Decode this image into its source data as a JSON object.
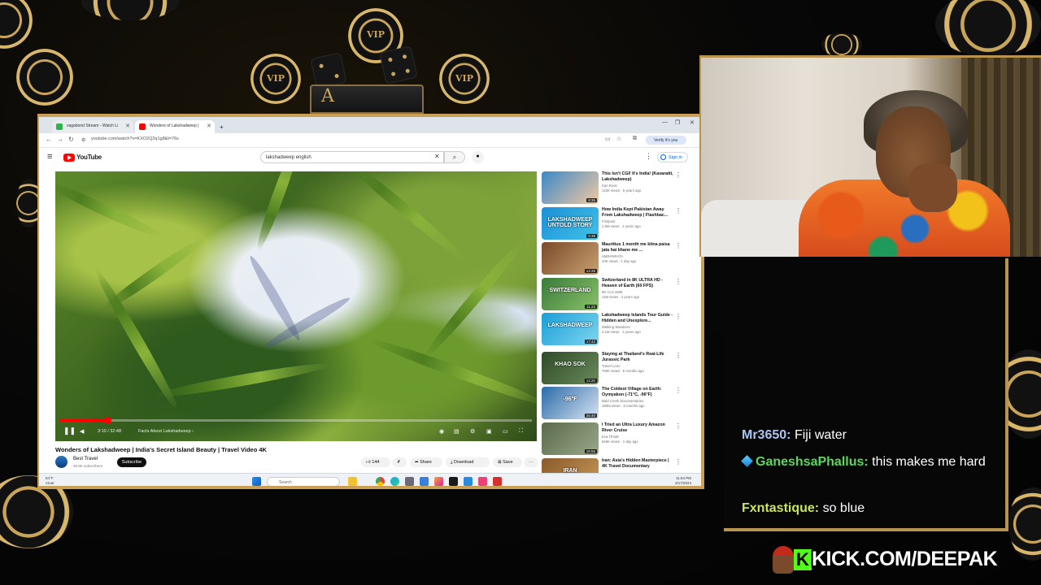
{
  "overlay": {
    "chip_text": "VIP",
    "card_letter": "A",
    "kick_banner": "KICK.COM/DEEPAK",
    "kick_logo_letter": "K"
  },
  "browser": {
    "tabs": [
      {
        "label": "vagabond Stream - Watch Li",
        "favicon_color": "#2db34a"
      },
      {
        "label": "Wonders of Lakshadweep |",
        "favicon_color": "#ff0000"
      }
    ],
    "new_tab_label": "+",
    "url": "youtube.com/watch?v=KXO2Q2q1g8&t=76s",
    "verify_label": "Verify it's you",
    "window_controls": [
      "—",
      "❐",
      "✕"
    ]
  },
  "youtube": {
    "logo_text": "YouTube",
    "search_value": "lakshadweep english",
    "sign_in_label": "Sign in",
    "video": {
      "time": "3:10 / 32:48",
      "chapter": "Facts About Lakshadweep ›",
      "progress": 0.1,
      "title": "Wonders of Lakshadweep | India's Secret Island Beauty | Travel Video 4K",
      "channel": "Best Travel",
      "subscribers": "26.8K subscribers",
      "subscribe_label": "Subscribe",
      "likes": "144",
      "share_label": "Share",
      "download_label": "Download",
      "save_label": "Save",
      "more_label": "···"
    },
    "recommendations": [
      {
        "title": "This Isn't CGI! It's India! (Kavaratti, Lakshadweep)",
        "channel": "Kan Rock",
        "meta": "142K views · 6 years ago",
        "duration": "8:35",
        "thumb": [
          "#3a88c8",
          "#f2c9a0"
        ]
      },
      {
        "title": "How India Kept Pakistan Away From Lakshadweep | Flashbac...",
        "channel": "Firstpost",
        "meta": "1.5M views · 2 years ago",
        "duration": "9:39",
        "thumb": [
          "#1e8fd6",
          "#3fc2e8"
        ]
      },
      {
        "title": "Mauritius 1 month me kitna paisa jata hai khane me ...",
        "channel": "AMRANRATA",
        "meta": "10K views · 1 day ago",
        "duration": "14:25",
        "thumb": [
          "#7a4a2a",
          "#c8a070"
        ]
      },
      {
        "title": "Switzerland in 8K ULTRA HD - Heaven of Earth (60 FPS)",
        "channel": "8K CLS 2605",
        "meta": "11M views · 2 years ago",
        "duration": "11:23",
        "thumb": [
          "#3a7a3a",
          "#8ac36a"
        ]
      },
      {
        "title": "Lakshadweep Islands Tour Guide - Hidden and Unexplore...",
        "channel": "Walking Wanderer",
        "meta": "4.1M views · 2 years ago",
        "duration": "17:43",
        "thumb": [
          "#1a9fd8",
          "#7fd6f0"
        ]
      },
      {
        "title": "Staying at Thailand's Real-Life Jurassic Park",
        "channel": "Travel Lens",
        "meta": "765K views · 5 months ago",
        "duration": "13:20",
        "thumb": [
          "#2f4a2a",
          "#6a8a5a"
        ]
      },
      {
        "title": "The Coldest Village on Earth: Oymyakon (-71°C, -96°F)",
        "channel": "Bald Creek Documentaries",
        "meta": "180M views · 6 months ago",
        "duration": "25:40",
        "thumb": [
          "#2a6aa8",
          "#d8e4f2"
        ]
      },
      {
        "title": "I Tried an Ultra Luxury Amazon River Cruise",
        "channel": "Eva Tthrall",
        "meta": "846K views · 1 day ago",
        "duration": "19:55",
        "thumb": [
          "#5a6a4a",
          "#9aa88a"
        ]
      },
      {
        "title": "Iran: Asia's Hidden Masterpiece | 4K Travel Documentary",
        "channel": "",
        "meta": "",
        "duration": "",
        "thumb": [
          "#8a5a2a",
          "#c89a5a"
        ]
      }
    ],
    "rec_thumb_words": [
      "",
      "LAKSHADWEEP UNTOLD STORY",
      "",
      "SWITZERLAND",
      "LAKSHADWEEP",
      "KHAO SOK",
      "-96°F",
      "",
      "IRAN"
    ]
  },
  "taskbar": {
    "weather_temp": "84°F",
    "weather_desc": "Clear",
    "search_placeholder": "Search",
    "time": "11:54 PM",
    "date": "3/17/2024"
  },
  "chat": {
    "messages": [
      {
        "user": "Mr3650",
        "text": "Fiji water",
        "color": "#a9c6f0",
        "badge": false
      },
      {
        "user": "GaneshsaPhallus",
        "text": "this makes me hard",
        "color": "#5cd65c",
        "badge": true
      },
      {
        "user": "Fxntastique",
        "text": "so blue",
        "color": "#c8e65a",
        "badge": false
      }
    ]
  }
}
